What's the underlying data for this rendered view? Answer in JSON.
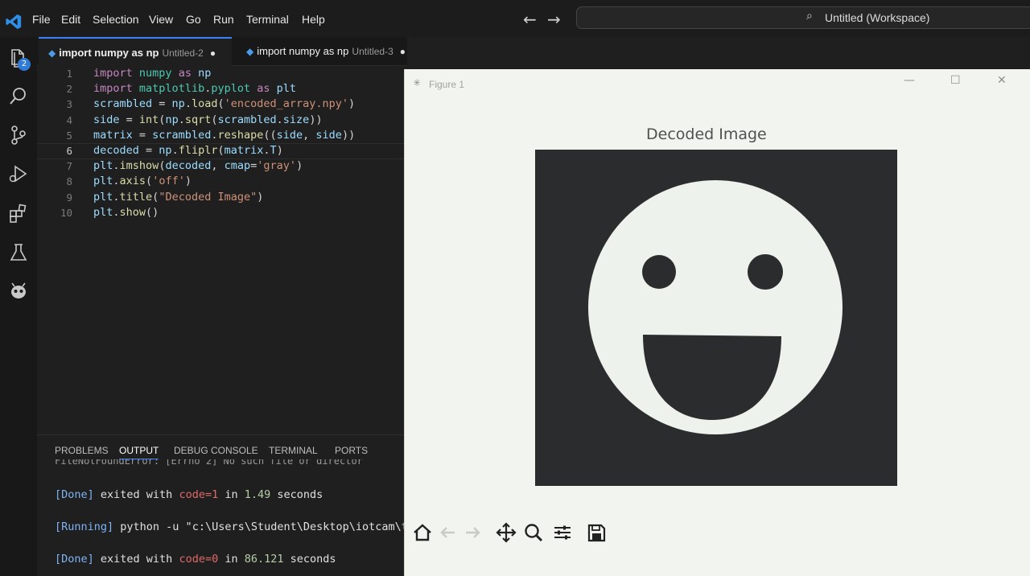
{
  "menu": [
    "File",
    "Edit",
    "Selection",
    "View",
    "Go",
    "Run",
    "Terminal",
    "Help"
  ],
  "command_center": {
    "label": "Untitled (Workspace)"
  },
  "activity": {
    "explorer_badge": "2"
  },
  "tabs": [
    {
      "name": "import numpy as np",
      "desc": "Untitled-2",
      "dirty": "●"
    },
    {
      "name": "import numpy as np",
      "desc": "Untitled-3",
      "dirty": "●"
    }
  ],
  "editor": {
    "line_numbers": [
      "1",
      "2",
      "3",
      "4",
      "5",
      "6",
      "7",
      "8",
      "9",
      "10"
    ],
    "lines": [
      "import numpy as np",
      "import matplotlib.pyplot as plt",
      "scrambled = np.load('encoded_array.npy')",
      "side = int(np.sqrt(scrambled.size))",
      "matrix = scrambled.reshape((side, side))",
      "decoded = np.fliplr(matrix.T)",
      "plt.imshow(decoded, cmap='gray')",
      "plt.axis('off')",
      "plt.title(\"Decoded Image\")",
      "plt.show()"
    ]
  },
  "panel": {
    "tabs": [
      "PROBLEMS",
      "OUTPUT",
      "DEBUG CONSOLE",
      "TERMINAL",
      "PORTS"
    ],
    "clipped_line": "FileNotFoundError: [Errno 2] No such file or director",
    "output": [
      {
        "tag": "[Done]",
        "text": " exited with ",
        "code": "code=1",
        "mid": " in ",
        "time": "1.49",
        "unit": " seconds"
      },
      {
        "tag": "[Running]",
        "text": " python -u \"c:\\Users\\Student\\Desktop\\iotcam\\tempCodeRunnerFile.python"
      },
      {
        "tag": "[Done]",
        "text": " exited with ",
        "code": "code=0",
        "mid": " in ",
        "time": "86.121",
        "unit": " seconds"
      }
    ]
  },
  "figure": {
    "window_title": "Figure 1",
    "plot_title": "Decoded Image",
    "image_background": "#2a2c2e",
    "image_foreground": "#eef2ec",
    "toolbar": [
      "home-icon",
      "back-icon",
      "forward-icon",
      "pan-icon",
      "zoom-icon",
      "configure-icon",
      "save-icon"
    ]
  },
  "colors": {
    "accent": "#3b82f6",
    "editor_bg": "#1f1f1f",
    "figure_bg": "#f2f5ef"
  }
}
